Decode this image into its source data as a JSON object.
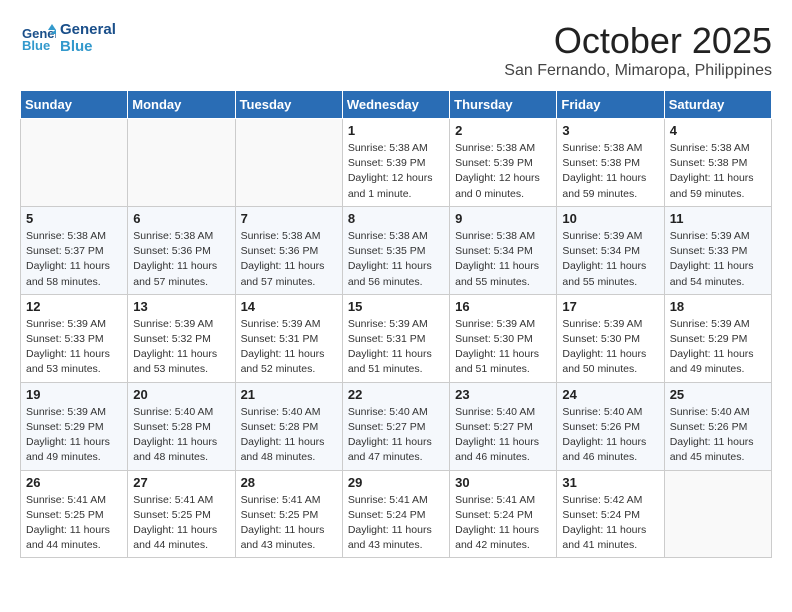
{
  "header": {
    "logo_line1": "General",
    "logo_line2": "Blue",
    "month": "October 2025",
    "location": "San Fernando, Mimaropa, Philippines"
  },
  "days_of_week": [
    "Sunday",
    "Monday",
    "Tuesday",
    "Wednesday",
    "Thursday",
    "Friday",
    "Saturday"
  ],
  "weeks": [
    [
      {
        "day": "",
        "detail": ""
      },
      {
        "day": "",
        "detail": ""
      },
      {
        "day": "",
        "detail": ""
      },
      {
        "day": "1",
        "detail": "Sunrise: 5:38 AM\nSunset: 5:39 PM\nDaylight: 12 hours\nand 1 minute."
      },
      {
        "day": "2",
        "detail": "Sunrise: 5:38 AM\nSunset: 5:39 PM\nDaylight: 12 hours\nand 0 minutes."
      },
      {
        "day": "3",
        "detail": "Sunrise: 5:38 AM\nSunset: 5:38 PM\nDaylight: 11 hours\nand 59 minutes."
      },
      {
        "day": "4",
        "detail": "Sunrise: 5:38 AM\nSunset: 5:38 PM\nDaylight: 11 hours\nand 59 minutes."
      }
    ],
    [
      {
        "day": "5",
        "detail": "Sunrise: 5:38 AM\nSunset: 5:37 PM\nDaylight: 11 hours\nand 58 minutes."
      },
      {
        "day": "6",
        "detail": "Sunrise: 5:38 AM\nSunset: 5:36 PM\nDaylight: 11 hours\nand 57 minutes."
      },
      {
        "day": "7",
        "detail": "Sunrise: 5:38 AM\nSunset: 5:36 PM\nDaylight: 11 hours\nand 57 minutes."
      },
      {
        "day": "8",
        "detail": "Sunrise: 5:38 AM\nSunset: 5:35 PM\nDaylight: 11 hours\nand 56 minutes."
      },
      {
        "day": "9",
        "detail": "Sunrise: 5:38 AM\nSunset: 5:34 PM\nDaylight: 11 hours\nand 55 minutes."
      },
      {
        "day": "10",
        "detail": "Sunrise: 5:39 AM\nSunset: 5:34 PM\nDaylight: 11 hours\nand 55 minutes."
      },
      {
        "day": "11",
        "detail": "Sunrise: 5:39 AM\nSunset: 5:33 PM\nDaylight: 11 hours\nand 54 minutes."
      }
    ],
    [
      {
        "day": "12",
        "detail": "Sunrise: 5:39 AM\nSunset: 5:33 PM\nDaylight: 11 hours\nand 53 minutes."
      },
      {
        "day": "13",
        "detail": "Sunrise: 5:39 AM\nSunset: 5:32 PM\nDaylight: 11 hours\nand 53 minutes."
      },
      {
        "day": "14",
        "detail": "Sunrise: 5:39 AM\nSunset: 5:31 PM\nDaylight: 11 hours\nand 52 minutes."
      },
      {
        "day": "15",
        "detail": "Sunrise: 5:39 AM\nSunset: 5:31 PM\nDaylight: 11 hours\nand 51 minutes."
      },
      {
        "day": "16",
        "detail": "Sunrise: 5:39 AM\nSunset: 5:30 PM\nDaylight: 11 hours\nand 51 minutes."
      },
      {
        "day": "17",
        "detail": "Sunrise: 5:39 AM\nSunset: 5:30 PM\nDaylight: 11 hours\nand 50 minutes."
      },
      {
        "day": "18",
        "detail": "Sunrise: 5:39 AM\nSunset: 5:29 PM\nDaylight: 11 hours\nand 49 minutes."
      }
    ],
    [
      {
        "day": "19",
        "detail": "Sunrise: 5:39 AM\nSunset: 5:29 PM\nDaylight: 11 hours\nand 49 minutes."
      },
      {
        "day": "20",
        "detail": "Sunrise: 5:40 AM\nSunset: 5:28 PM\nDaylight: 11 hours\nand 48 minutes."
      },
      {
        "day": "21",
        "detail": "Sunrise: 5:40 AM\nSunset: 5:28 PM\nDaylight: 11 hours\nand 48 minutes."
      },
      {
        "day": "22",
        "detail": "Sunrise: 5:40 AM\nSunset: 5:27 PM\nDaylight: 11 hours\nand 47 minutes."
      },
      {
        "day": "23",
        "detail": "Sunrise: 5:40 AM\nSunset: 5:27 PM\nDaylight: 11 hours\nand 46 minutes."
      },
      {
        "day": "24",
        "detail": "Sunrise: 5:40 AM\nSunset: 5:26 PM\nDaylight: 11 hours\nand 46 minutes."
      },
      {
        "day": "25",
        "detail": "Sunrise: 5:40 AM\nSunset: 5:26 PM\nDaylight: 11 hours\nand 45 minutes."
      }
    ],
    [
      {
        "day": "26",
        "detail": "Sunrise: 5:41 AM\nSunset: 5:25 PM\nDaylight: 11 hours\nand 44 minutes."
      },
      {
        "day": "27",
        "detail": "Sunrise: 5:41 AM\nSunset: 5:25 PM\nDaylight: 11 hours\nand 44 minutes."
      },
      {
        "day": "28",
        "detail": "Sunrise: 5:41 AM\nSunset: 5:25 PM\nDaylight: 11 hours\nand 43 minutes."
      },
      {
        "day": "29",
        "detail": "Sunrise: 5:41 AM\nSunset: 5:24 PM\nDaylight: 11 hours\nand 43 minutes."
      },
      {
        "day": "30",
        "detail": "Sunrise: 5:41 AM\nSunset: 5:24 PM\nDaylight: 11 hours\nand 42 minutes."
      },
      {
        "day": "31",
        "detail": "Sunrise: 5:42 AM\nSunset: 5:24 PM\nDaylight: 11 hours\nand 41 minutes."
      },
      {
        "day": "",
        "detail": ""
      }
    ]
  ]
}
